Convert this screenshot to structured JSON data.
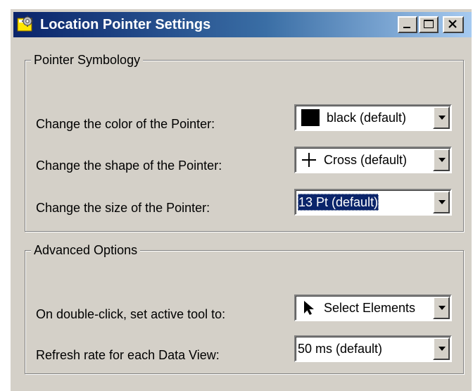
{
  "window": {
    "title": "Location Pointer Settings"
  },
  "title_buttons": {
    "minimize_icon": "minimize-icon",
    "maximize_icon": "maximize-icon",
    "close_icon": "close-icon"
  },
  "pointer_symbology": {
    "legend": "Pointer Symbology",
    "color": {
      "label": "Change the color of the Pointer:",
      "value": "black (default)",
      "swatch_color": "#000000",
      "icon": "color-swatch-icon"
    },
    "shape": {
      "label": "Change the shape of the Pointer:",
      "value": "Cross (default)",
      "icon": "cross-icon"
    },
    "size": {
      "label": "Change the size of the Pointer:",
      "value": "13 Pt (default)"
    }
  },
  "advanced_options": {
    "legend": "Advanced Options",
    "double_click": {
      "label": "On double-click, set active tool to:",
      "value": "Select Elements",
      "icon": "arrow-pointer-icon"
    },
    "refresh_rate": {
      "label": "Refresh rate for each Data View:",
      "value": "50 ms (default)"
    }
  },
  "colors": {
    "title_bar_start": "#0a246a",
    "title_bar_end": "#a6caf0",
    "face": "#d4d0c8",
    "selection": "#0a246a"
  }
}
